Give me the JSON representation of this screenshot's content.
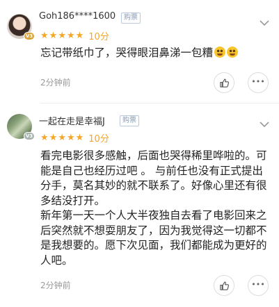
{
  "reviews": [
    {
      "username": "Goh186****1600",
      "purchase_badge": "购票",
      "stars": [
        "★",
        "★",
        "★",
        "★",
        "★"
      ],
      "score": "10分",
      "content": [
        "忘记带纸巾了，哭得眼泪鼻涕一包糟"
      ],
      "time": "2分钟前"
    },
    {
      "username": "一起在走是幸福J",
      "purchase_badge": "购票",
      "stars": [
        "★",
        "★",
        "★",
        "★",
        "★"
      ],
      "score": "10分",
      "content": [
        "看完电影很多感触，后面也哭得稀里哗啦的。可能是自己也经历过吧 。 与前任也没有正式提出分手，莫名其妙的就不联系了。好像心里还有很多结没打开。",
        "新年第一天一个人大半夜独自去看了电影回来之后突然就不想耍朋友了，因为我觉得这一切都不是我想要的。愿下次见面，我们都能成为更好的人吧。"
      ],
      "time": "2分钟前"
    }
  ],
  "colors": {
    "star": "#f5a623",
    "badge_border": "#b9c7dc",
    "badge_text": "#8a9bb5",
    "secondary_text": "#999999"
  },
  "icons": {
    "like": "thumbs-up-icon",
    "more": "more-dots-icon",
    "expand": "chevron-down-icon",
    "emoji": "rofl-emoji-icon"
  }
}
